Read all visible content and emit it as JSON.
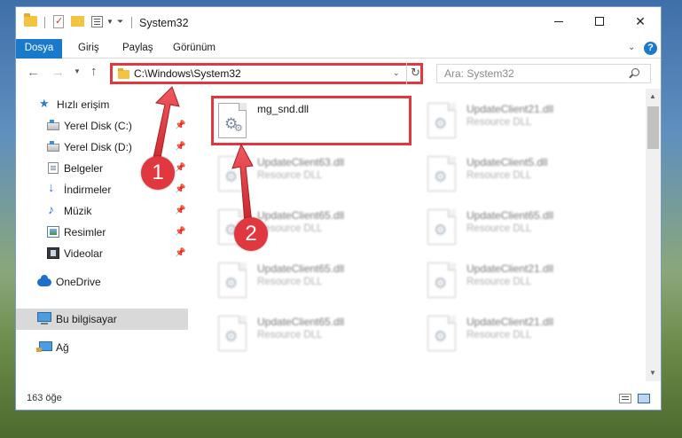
{
  "window": {
    "title": "System32",
    "controls": {
      "minimize": "",
      "maximize": "",
      "close": "✕"
    }
  },
  "ribbon": {
    "tabs": [
      "Dosya",
      "Giriş",
      "Paylaş",
      "Görünüm"
    ],
    "help": "?"
  },
  "navigation": {
    "address": "C:\\Windows\\System32",
    "search_placeholder": "Ara: System32"
  },
  "sidebar": {
    "items": [
      {
        "label": "Hızlı erişim",
        "icon": "star-icon"
      },
      {
        "label": "Yerel Disk (C:)",
        "icon": "disk-icon",
        "pinned": true
      },
      {
        "label": "Yerel Disk (D:)",
        "icon": "disk-icon",
        "pinned": true
      },
      {
        "label": "Belgeler",
        "icon": "documents-icon",
        "pinned": true
      },
      {
        "label": "İndirmeler",
        "icon": "download-icon",
        "pinned": true
      },
      {
        "label": "Müzik",
        "icon": "music-icon",
        "pinned": true
      },
      {
        "label": "Resimler",
        "icon": "pictures-icon",
        "pinned": true
      },
      {
        "label": "Videolar",
        "icon": "videos-icon",
        "pinned": true
      },
      {
        "label": "OneDrive",
        "icon": "cloud-icon"
      },
      {
        "label": "Bu bilgisayar",
        "icon": "computer-icon",
        "selected": true
      },
      {
        "label": "Ağ",
        "icon": "network-icon"
      }
    ]
  },
  "files": [
    {
      "name": "mg_snd.dll",
      "type": "",
      "highlighted": true
    },
    {
      "name": "UpdateClient21.dll",
      "type": "Resource DLL"
    },
    {
      "name": "UpdateClient63.dll",
      "type": "Resource DLL"
    },
    {
      "name": "UpdateClient5.dll",
      "type": "Resource DLL"
    },
    {
      "name": "UpdateClient65.dll",
      "type": "Resource DLL"
    },
    {
      "name": "UpdateClient65.dll",
      "type": "Resource DLL"
    },
    {
      "name": "UpdateClient65.dll",
      "type": "Resource DLL"
    },
    {
      "name": "UpdateClient21.dll",
      "type": "Resource DLL"
    },
    {
      "name": "UpdateClient65.dll",
      "type": "Resource DLL"
    },
    {
      "name": "UpdateClient21.dll",
      "type": "Resource DLL"
    }
  ],
  "status": {
    "item_count": "163 öğe"
  },
  "annotations": {
    "step1": "1",
    "step2": "2"
  },
  "colors": {
    "accent": "#1979ca",
    "annotation": "#e0383e"
  }
}
